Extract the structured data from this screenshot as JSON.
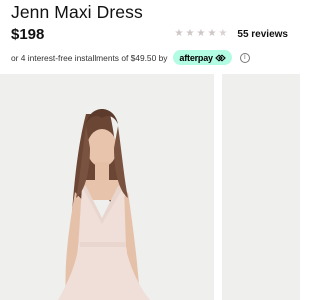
{
  "product": {
    "title": "Jenn Maxi Dress",
    "price": "$198"
  },
  "rating": {
    "stars": [
      "star-icon",
      "star-icon",
      "star-icon",
      "star-icon",
      "star-icon"
    ],
    "reviews_label": "55 reviews",
    "star_color": "#cfc6c6"
  },
  "installments": {
    "text": "or 4 interest-free installments of $49.50 by",
    "provider_label": "afterpay",
    "badge_color": "#b2fce4",
    "info_icon": "info-icon"
  },
  "gallery": {
    "background_color": "#efefee",
    "dress_color": "#efdfd8"
  }
}
